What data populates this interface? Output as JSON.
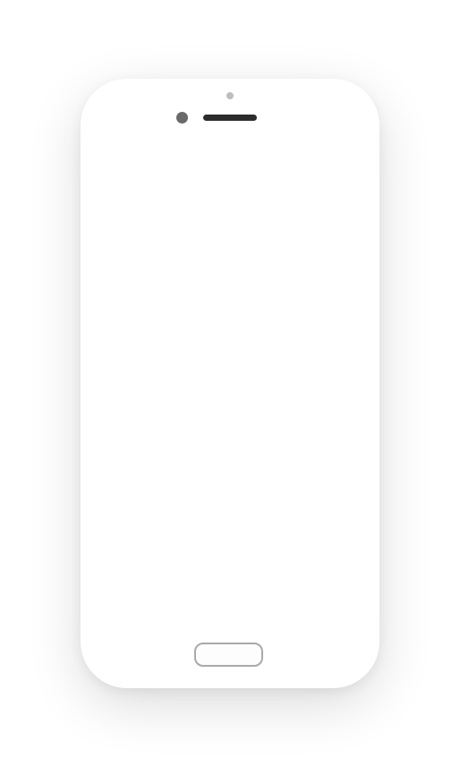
{
  "device": {
    "type": "smartphone mockup",
    "screen": {
      "content": ""
    },
    "colors": {
      "body": "#ffffff",
      "speaker": "#2c2c2c",
      "camera": "#6a6a6a",
      "sensor": "#bdbdbd",
      "home_button_border": "#a9a9a9"
    }
  }
}
